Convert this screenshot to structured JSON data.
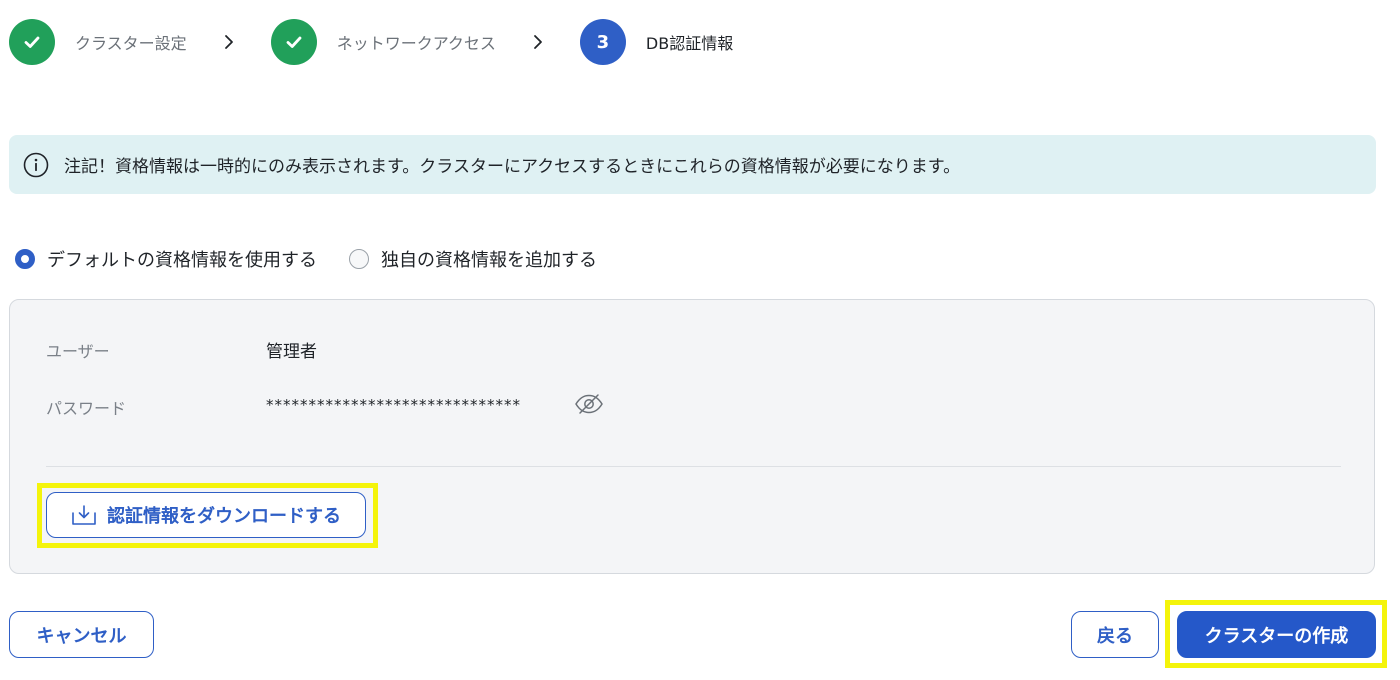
{
  "stepper": {
    "steps": [
      {
        "label": "クラスター設定",
        "state": "done"
      },
      {
        "label": "ネットワークアクセス",
        "state": "done"
      },
      {
        "number": "3",
        "label": "DB認証情報",
        "state": "current"
      }
    ]
  },
  "banner": {
    "icon": "info-icon",
    "text": "注記！資格情報は一時的にのみ表示されます。クラスターにアクセスするときにこれらの資格情報が必要になります。"
  },
  "credential_mode": {
    "options": [
      {
        "label": "デフォルトの資格情報を使用する",
        "selected": true
      },
      {
        "label": "独自の資格情報を追加する",
        "selected": false
      }
    ]
  },
  "credentials": {
    "user_label": "ユーザー",
    "user_value": "管理者",
    "password_label": "パスワード",
    "password_value": "******************************",
    "toggle_icon": "eye-off-icon",
    "download_label": "認証情報をダウンロードする",
    "download_icon": "download-icon"
  },
  "footer": {
    "cancel_label": "キャンセル",
    "back_label": "戻る",
    "create_label": "クラスターの作成"
  },
  "colors": {
    "primary": "#2558c9",
    "success": "#21a05a",
    "banner_bg": "#dff1f3",
    "highlight": "#f4f40b"
  }
}
